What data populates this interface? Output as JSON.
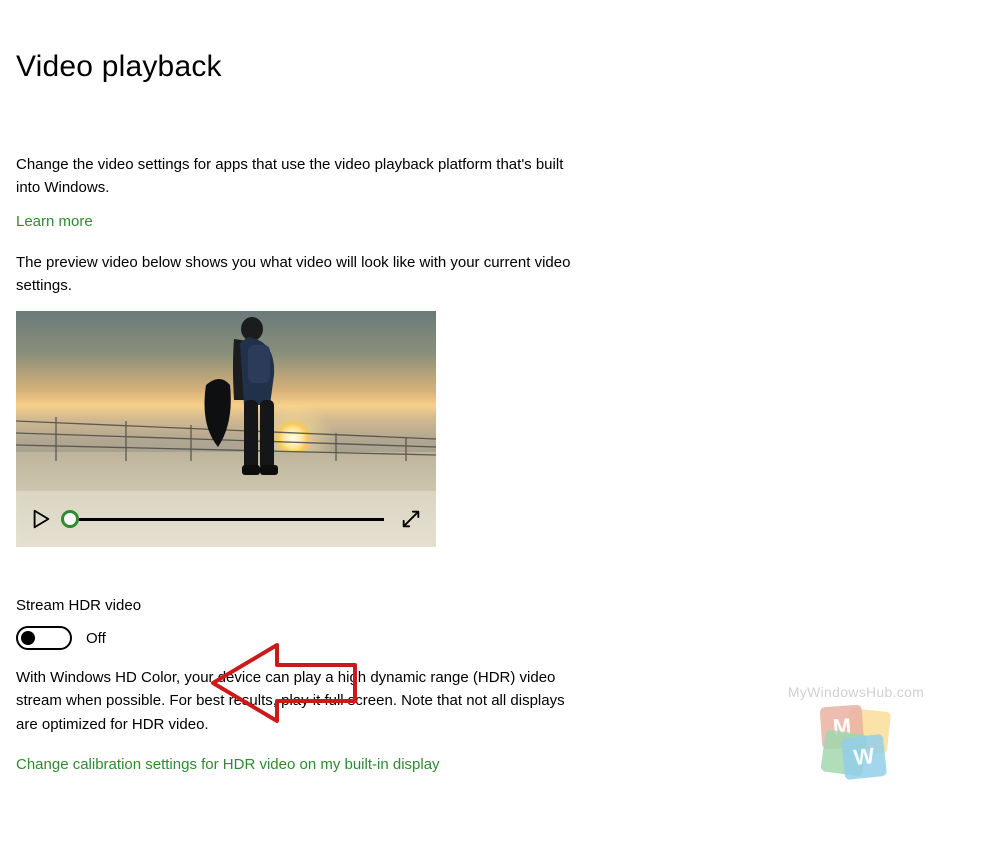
{
  "page": {
    "title": "Video playback",
    "intro": "Change the video settings for apps that use the video playback platform that's built into Windows.",
    "learn_more": "Learn more",
    "preview_note": "The preview video below shows you what video will look like with your current video settings."
  },
  "video": {
    "play_icon": "play-icon",
    "fullscreen_icon": "fullscreen-icon",
    "progress_position": 0
  },
  "hdr": {
    "label": "Stream HDR video",
    "state": "Off",
    "description": "With Windows HD Color, your device can play a high dynamic range (HDR) video stream when possible. For best results, play it full screen. Note that not all displays are optimized for HDR video.",
    "calibration_link": "Change calibration settings for HDR video on my built-in display"
  },
  "watermark": {
    "text": "MyWindowsHub.com",
    "letters": {
      "m": "M",
      "w": "W"
    }
  }
}
